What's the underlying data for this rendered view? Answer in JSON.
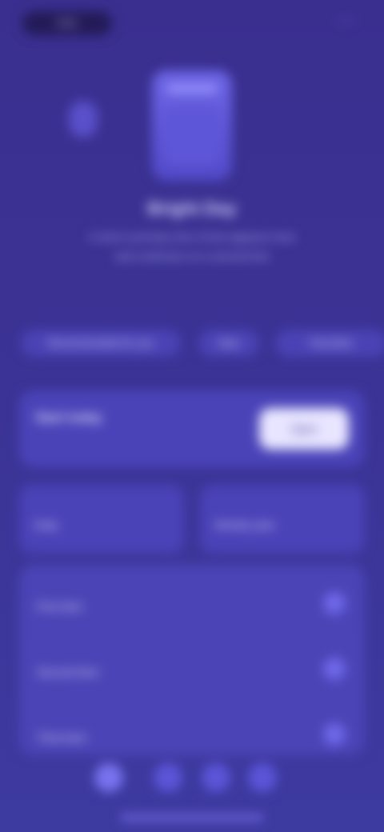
{
  "status": {
    "time": "9:41"
  },
  "top_right": {
    "glyph": "⋯"
  },
  "hero": {
    "title": "Bright Day",
    "subtitle_line1": "A short summary line of text appears here",
    "subtitle_line2": "and continues on a second line"
  },
  "tabs": [
    {
      "label": "Recommended for you"
    },
    {
      "label": "New"
    },
    {
      "label": "Favorites"
    }
  ],
  "card_primary": {
    "label": "Start today",
    "button_label": "Open"
  },
  "mini_cards": [
    {
      "label": "Daily"
    },
    {
      "label": "Weekly plan"
    }
  ],
  "list_items": [
    {
      "label": "First item"
    },
    {
      "label": "Second item"
    },
    {
      "label": "Third item"
    }
  ],
  "icons": {
    "top_right": "more-icon",
    "left_glyph": "sparkle-icon",
    "hero": "device-icon",
    "list_right": "chevron-icon"
  }
}
